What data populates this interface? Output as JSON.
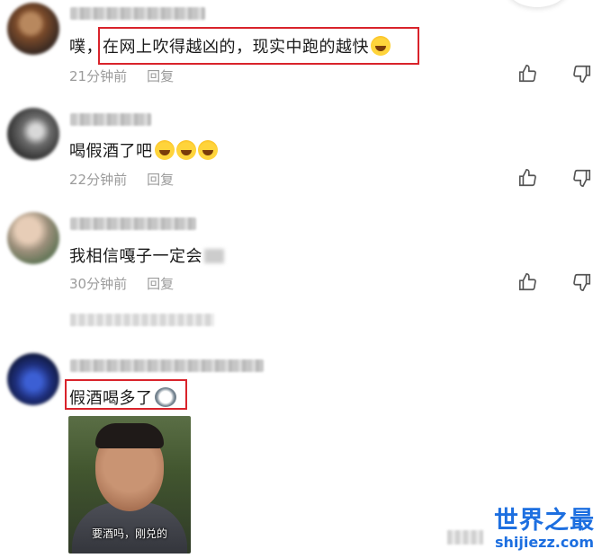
{
  "comments": [
    {
      "text": "噗，在网上吹得越凶的，现实中跑的越快",
      "time": "21分钟前",
      "reply": "回复",
      "emoji": "rofl-emoji"
    },
    {
      "text": "喝假酒了吧",
      "time": "22分钟前",
      "reply": "回复",
      "emoji": "laughing-crying-emoji"
    },
    {
      "text": "我相信嘎子一定会",
      "time": "30分钟前",
      "reply": "回复"
    },
    {
      "text": "假酒喝多了",
      "emoji": "husky-emoji",
      "meme_caption": "要酒吗，刚兑的"
    }
  ],
  "watermark": {
    "title": "世界之最",
    "subtitle": "shijiezz.com"
  },
  "colors": {
    "highlight": "#d9232b",
    "watermark": "#1d6fe0",
    "meta": "#9b9b9b"
  },
  "icons": [
    "thumbs-up-icon",
    "thumbs-down-icon"
  ]
}
